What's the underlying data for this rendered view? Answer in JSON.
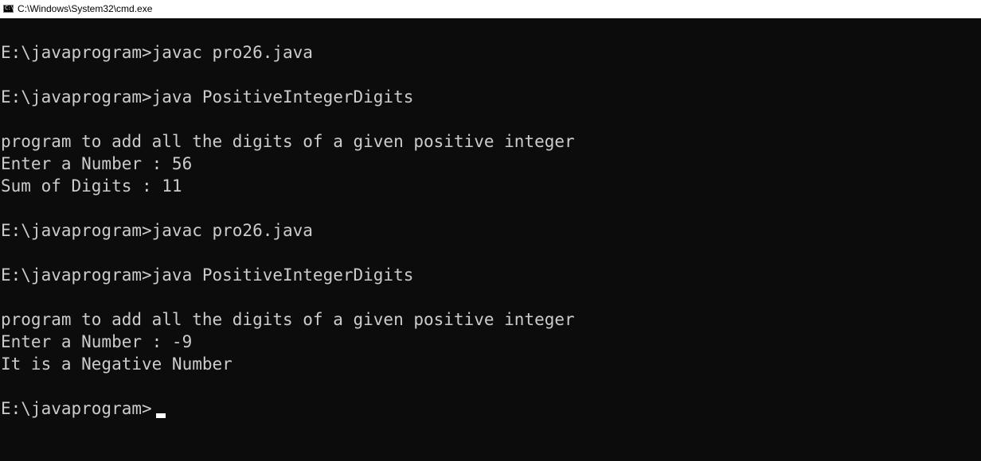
{
  "window": {
    "title": "C:\\Windows\\System32\\cmd.exe",
    "icon": "console-icon",
    "icon_glyph": "C:\\",
    "background_color": "#0c0c0c",
    "text_color": "#cccccc"
  },
  "console": {
    "lines": [
      "E:\\javaprogram>javac pro26.java",
      "E:\\javaprogram>java PositiveIntegerDigits",
      "program to add all the digits of a given positive integer",
      "Enter a Number : 56",
      "Sum of Digits : 11",
      "E:\\javaprogram>javac pro26.java",
      "E:\\javaprogram>java PositiveIntegerDigits",
      "program to add all the digits of a given positive integer",
      "Enter a Number : -9",
      "It is a Negative Number",
      "E:\\javaprogram>"
    ]
  }
}
